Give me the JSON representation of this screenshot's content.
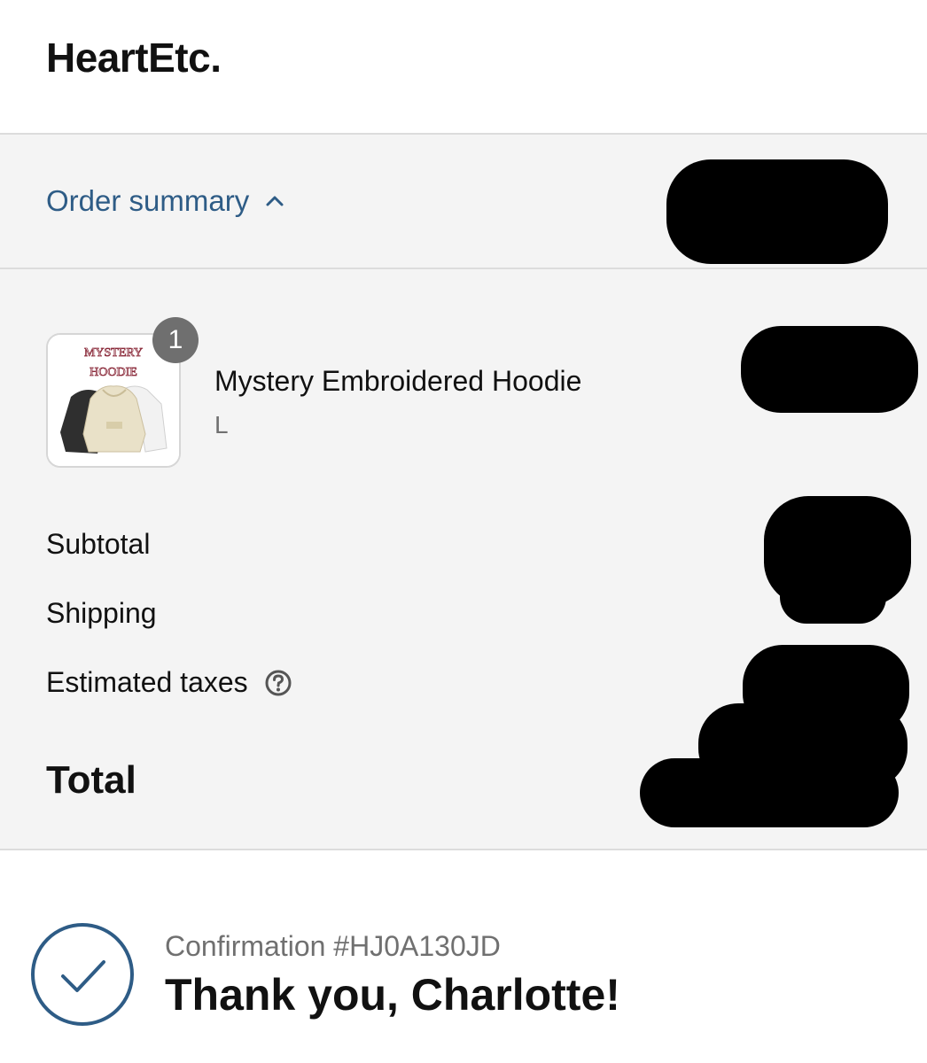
{
  "brand": {
    "name": "HeartEtc."
  },
  "summary_toggle": {
    "label": "Order summary",
    "icon": "chevron-up-icon"
  },
  "line_items": [
    {
      "quantity": "1",
      "name": "Mystery Embroidered Hoodie",
      "variant": "L",
      "thumb_text_line1": "MYSTERY",
      "thumb_text_line2": "HOODIE"
    }
  ],
  "summary_rows": {
    "subtotal_label": "Subtotal",
    "shipping_label": "Shipping",
    "taxes_label": "Estimated taxes",
    "total_label": "Total"
  },
  "confirmation": {
    "number_text": "Confirmation #HJ0A130JD",
    "thank_you": "Thank you, Charlotte!"
  },
  "colors": {
    "accent": "#2e5c86",
    "panel_bg": "#f4f4f4",
    "badge_bg": "#6f6f6f",
    "muted_text": "#707070"
  }
}
